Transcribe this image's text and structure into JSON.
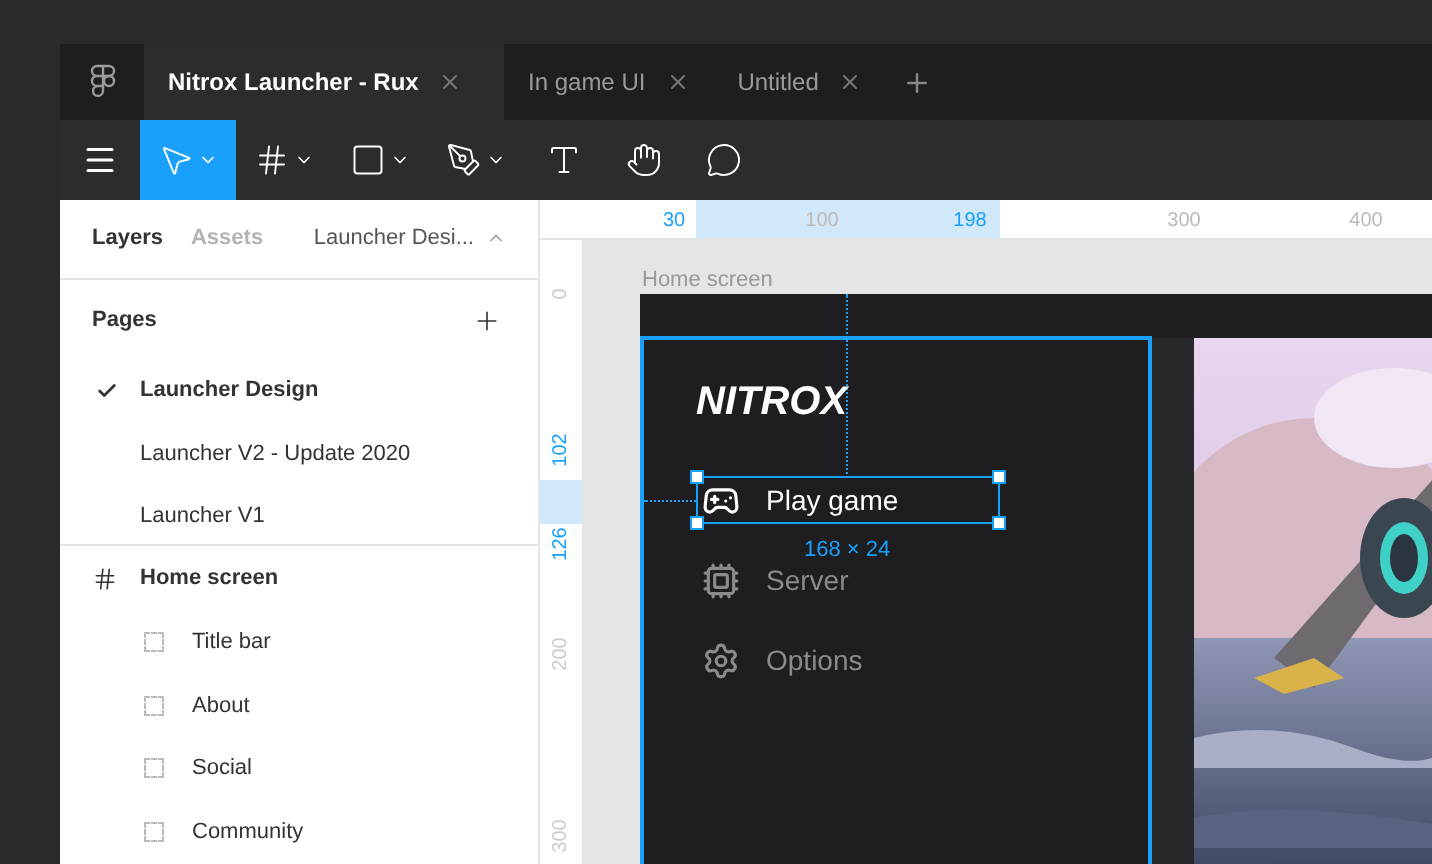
{
  "tabs": [
    {
      "label": "Nitrox Launcher - Rux",
      "selected": true
    },
    {
      "label": "In game UI",
      "selected": false
    },
    {
      "label": "Untitled",
      "selected": false
    }
  ],
  "toolbar": [
    {
      "kind": "move",
      "selected": true,
      "dropdown": true
    },
    {
      "kind": "frame",
      "selected": false,
      "dropdown": true
    },
    {
      "kind": "shape",
      "selected": false,
      "dropdown": true
    },
    {
      "kind": "pen",
      "selected": false,
      "dropdown": true
    },
    {
      "kind": "text",
      "selected": false,
      "dropdown": false
    },
    {
      "kind": "hand",
      "selected": false,
      "dropdown": false
    },
    {
      "kind": "comment",
      "selected": false,
      "dropdown": false
    }
  ],
  "panel": {
    "tabs": [
      {
        "label": "Layers",
        "selected": true
      },
      {
        "label": "Assets",
        "selected": false
      }
    ],
    "page_selector": "Launcher Desi...",
    "pages_heading": "Pages",
    "pages": [
      {
        "label": "Launcher Design",
        "selected": true
      },
      {
        "label": "Launcher V2 - Update 2020",
        "selected": false
      },
      {
        "label": "Launcher V1",
        "selected": false
      }
    ],
    "layers": [
      {
        "label": "Home screen",
        "kind": "frame",
        "children": [
          {
            "label": "Title bar",
            "kind": "group"
          },
          {
            "label": "About",
            "kind": "group"
          },
          {
            "label": "Social",
            "kind": "group"
          },
          {
            "label": "Community",
            "kind": "group"
          }
        ]
      }
    ]
  },
  "rulers": {
    "top": [
      {
        "label": "30",
        "highlighted": true
      },
      {
        "label": "100",
        "highlighted": false
      },
      {
        "label": "198",
        "highlighted": true
      },
      {
        "label": "300",
        "highlighted": false
      },
      {
        "label": "400",
        "highlighted": false
      }
    ],
    "left": [
      {
        "label": "0",
        "highlighted": false
      },
      {
        "label": "102",
        "highlighted": true
      },
      {
        "label": "126",
        "highlighted": true
      },
      {
        "label": "200",
        "highlighted": false
      },
      {
        "label": "300",
        "highlighted": false
      }
    ]
  },
  "canvas": {
    "frame_label": "Home screen",
    "logo": "NITROX",
    "menu": [
      {
        "label": "Play game",
        "kind": "gamepad",
        "selected": true
      },
      {
        "label": "Server",
        "kind": "chip",
        "selected": false
      },
      {
        "label": "Options",
        "kind": "gear",
        "selected": false
      }
    ],
    "selection_size": "168 × 24"
  }
}
